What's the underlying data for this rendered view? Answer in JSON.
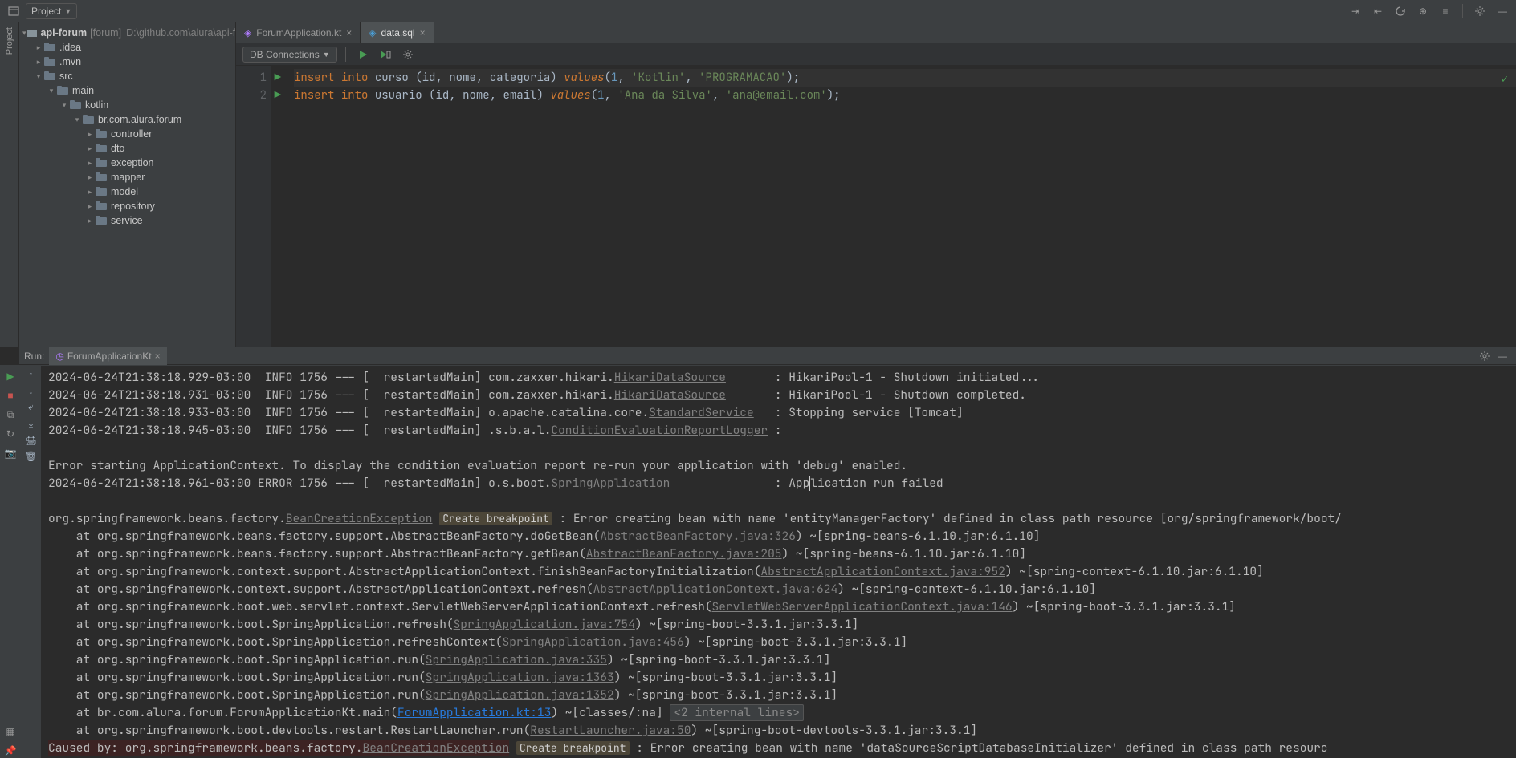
{
  "toolbar": {
    "project_label": "Project"
  },
  "project_pane": {
    "title": "api-forum",
    "bracket": "[forum]",
    "path": "D:\\github.com\\alura\\api-forum",
    "tree": [
      {
        "name": ".idea",
        "expandable": true,
        "level": 1,
        "folderClass": "folder-yellow"
      },
      {
        "name": ".mvn",
        "expandable": true,
        "level": 1
      },
      {
        "name": "src",
        "expandable": true,
        "expanded": true,
        "level": 1,
        "folderClass": "folder-blue"
      },
      {
        "name": "main",
        "expandable": true,
        "expanded": true,
        "level": 2,
        "folderClass": "folder-blue"
      },
      {
        "name": "kotlin",
        "expandable": true,
        "expanded": true,
        "level": 3,
        "folderClass": "folder-blue"
      },
      {
        "name": "br.com.alura.forum",
        "expandable": true,
        "expanded": true,
        "level": 4
      },
      {
        "name": "controller",
        "expandable": true,
        "level": 5
      },
      {
        "name": "dto",
        "expandable": true,
        "level": 5
      },
      {
        "name": "exception",
        "expandable": true,
        "level": 5
      },
      {
        "name": "mapper",
        "expandable": true,
        "level": 5
      },
      {
        "name": "model",
        "expandable": true,
        "level": 5
      },
      {
        "name": "repository",
        "expandable": true,
        "level": 5
      },
      {
        "name": "service",
        "expandable": true,
        "level": 5
      }
    ]
  },
  "editor": {
    "tabs": [
      {
        "name": "ForumApplication.kt",
        "icon": "kotlin"
      },
      {
        "name": "data.sql",
        "icon": "sql",
        "active": true
      }
    ],
    "db_conn_label": "DB Connections",
    "lines": [
      {
        "n": 1,
        "run": true,
        "html": "<span class='kw'>insert</span> <span class='kw'>into</span> <span class='id'>curso</span> <span class='pn'>(</span><span class='id'>id</span><span class='pn'>,</span> <span class='id'>nome</span><span class='pn'>,</span> <span class='id'>categoria</span><span class='pn'>)</span> <span class='fn-word'>values</span><span class='pn'>(</span><span class='num'>1</span><span class='pn'>,</span> <span class='str'>'Kotlin'</span><span class='pn'>,</span> <span class='str'>'PROGRAMACAO'</span><span class='pn'>);</span>"
      },
      {
        "n": 2,
        "run": true,
        "html": "<span class='kw'>insert</span> <span class='kw'>into</span> <span class='id'>usuario</span> <span class='pn'>(</span><span class='id'>id</span><span class='pn'>,</span> <span class='id'>nome</span><span class='pn'>,</span> <span class='id'>email</span><span class='pn'>)</span> <span class='fn-word'>values</span><span class='pn'>(</span><span class='num'>1</span><span class='pn'>,</span> <span class='str'>'Ana da Silva'</span><span class='pn'>,</span> <span class='str'>'ana@email.com'</span><span class='pn'>);</span>"
      }
    ]
  },
  "run": {
    "label": "Run:",
    "tab_name": "ForumApplicationKt",
    "lines": [
      "2024-06-24T21:38:18.929-03:00  INFO 1756 --- [  restartedMain] com.zaxxer.hikari.<span class='ulink'>HikariDataSource</span>       : HikariPool-1 - Shutdown initiated...",
      "2024-06-24T21:38:18.931-03:00  INFO 1756 --- [  restartedMain] com.zaxxer.hikari.<span class='ulink'>HikariDataSource</span>       : HikariPool-1 - Shutdown completed.",
      "2024-06-24T21:38:18.933-03:00  INFO 1756 --- [  restartedMain] o.apache.catalina.core.<span class='ulink'>StandardService</span>   : Stopping service [Tomcat]",
      "2024-06-24T21:38:18.945-03:00  INFO 1756 --- [  restartedMain] .s.b.a.l.<span class='ulink'>ConditionEvaluationReportLogger</span> :",
      "",
      "Error starting ApplicationContext. To display the condition evaluation report re-run your application with 'debug' enabled.",
      "2024-06-24T21:38:18.961-03:00 ERROR 1756 --- [  restartedMain] o.s.boot.<span class='ulink'>SpringApplication</span>               : App<span class='caret'></span>lication run failed",
      "",
      "org.springframework.beans.factory.<span class='ulink'>BeanCreationException</span> <span class='hint-box'>Create breakpoint</span> : Error creating bean with name 'entityManagerFactory' defined in class path resource [org/springframework/boot/",
      "    at org.springframework.beans.factory.support.AbstractBeanFactory.doGetBean(<span class='ulink'>AbstractBeanFactory.java:326</span>) ~[spring-beans-6.1.10.jar:6.1.10]",
      "    at org.springframework.beans.factory.support.AbstractBeanFactory.getBean(<span class='ulink'>AbstractBeanFactory.java:205</span>) ~[spring-beans-6.1.10.jar:6.1.10]",
      "    at org.springframework.context.support.AbstractApplicationContext.finishBeanFactoryInitialization(<span class='ulink'>AbstractApplicationContext.java:952</span>) ~[spring-context-6.1.10.jar:6.1.10]",
      "    at org.springframework.context.support.AbstractApplicationContext.refresh(<span class='ulink'>AbstractApplicationContext.java:624</span>) ~[spring-context-6.1.10.jar:6.1.10]",
      "    at org.springframework.boot.web.servlet.context.ServletWebServerApplicationContext.refresh(<span class='ulink'>ServletWebServerApplicationContext.java:146</span>) ~[spring-boot-3.3.1.jar:3.3.1]",
      "    at org.springframework.boot.SpringApplication.refresh(<span class='ulink'>SpringApplication.java:754</span>) ~[spring-boot-3.3.1.jar:3.3.1]",
      "    at org.springframework.boot.SpringApplication.refreshContext(<span class='ulink'>SpringApplication.java:456</span>) ~[spring-boot-3.3.1.jar:3.3.1]",
      "    at org.springframework.boot.SpringApplication.run(<span class='ulink'>SpringApplication.java:335</span>) ~[spring-boot-3.3.1.jar:3.3.1]",
      "    at org.springframework.boot.SpringApplication.run(<span class='ulink'>SpringApplication.java:1363</span>) ~[spring-boot-3.3.1.jar:3.3.1]",
      "    at org.springframework.boot.SpringApplication.run(<span class='ulink'>SpringApplication.java:1352</span>) ~[spring-boot-3.3.1.jar:3.3.1]",
      "    at br.com.alura.forum.ForumApplicationKt.main(<a class='link'>ForumApplication.kt:13</a>) ~[classes/:na] <span class='fold-badge'>&lt;2 internal lines&gt;</span>",
      "    at org.springframework.boot.devtools.restart.RestartLauncher.run(<span class='ulink'>RestartLauncher.java:50</span>) ~[spring-boot-devtools-3.3.1.jar:3.3.1]",
      "<span class='err-bg'>Caused by: org.springframework.beans.factory.<span class='ulink'>BeanCreationException</span></span> <span class='hint-box'>Create breakpoint</span> : Error creating bean with name 'dataSourceScriptDatabaseInitializer' defined in class path resourc"
    ]
  }
}
